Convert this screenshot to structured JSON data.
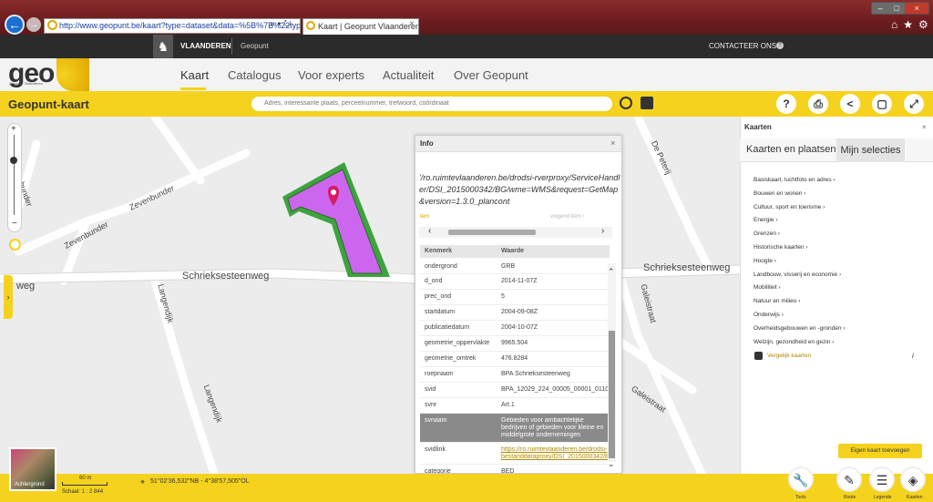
{
  "browser": {
    "url": "http://www.geopunt.be/kaart?type=dataset&data=%5B%7B%22type",
    "tab_title": "Kaart | Geopunt Vlaanderen",
    "win_controls": [
      "–",
      "□",
      "×"
    ]
  },
  "topbar": {
    "org": "VLAANDEREN",
    "site": "Geopunt",
    "contact": "CONTACTEER ONS",
    "help": "?"
  },
  "logo": {
    "word": "geo",
    "sub": "Geopunt Vlaanderen"
  },
  "nav": {
    "items": [
      "Kaart",
      "Catalogus",
      "Voor experts",
      "Actualiteit",
      "Over Geopunt"
    ]
  },
  "toolbar": {
    "title": "Geopunt-kaart",
    "search_placeholder": "Adres, interessante plaats, perceelnummer, trefwoord, coördinaat",
    "buttons": [
      {
        "icon": "help-icon",
        "glyph": "?"
      },
      {
        "icon": "print-icon",
        "glyph": "⎙"
      },
      {
        "icon": "share-icon",
        "glyph": "<"
      },
      {
        "icon": "bookmark-icon",
        "glyph": "▢"
      },
      {
        "icon": "fullscreen-icon",
        "glyph": "⤢"
      }
    ]
  },
  "map": {
    "roads": [
      "Schrieksesteenweg",
      "Schrieksesteenweg",
      "weg",
      "Zevenbunder",
      "Zevenbunder",
      "bunder",
      "Langendijk",
      "Langendijk",
      "Galeistraat",
      "Galeistraat",
      "De Peterij"
    ],
    "parcel_color": "#cc66ee",
    "parcel_border": "#3ea33e",
    "marker_color": "#d81b60"
  },
  "zoom": {
    "plus": "+",
    "minus": "−"
  },
  "info": {
    "title": "Info",
    "close": "×",
    "url": "'/ro.ruimtevlaanderen.be/drodsi-rverproxy/ServiceHandler/DSI_2015000342/BG/wme=WMS&request=GetMap&version=1.3.0_plancont",
    "prev": "tern",
    "next": "volgend item ›",
    "headers": [
      "Kenmerk",
      "Waarde"
    ],
    "rows": [
      {
        "k": "ondergrond",
        "v": "GRB"
      },
      {
        "k": "d_ond",
        "v": "2014-11-07Z"
      },
      {
        "k": "prec_ond",
        "v": "5"
      },
      {
        "k": "startdatum",
        "v": "2004-09-08Z"
      },
      {
        "k": "publicatiedatum",
        "v": "2004-10-07Z"
      },
      {
        "k": "geometrie_oppervlakte",
        "v": "9965.504"
      },
      {
        "k": "geometrie_omtrek",
        "v": "476.8284"
      },
      {
        "k": "roepnaam",
        "v": "BPA Schrieksesteenweg"
      },
      {
        "k": "svid",
        "v": "BPA_12029_224_00005_00001_01100"
      },
      {
        "k": "svnr",
        "v": "Art.1"
      },
      {
        "k": "svnaam",
        "v": "Gebieden voor ambachtelijke bedrijven of gebieden voor kleine en middelgrote ondernemingen"
      },
      {
        "k": "svidlink",
        "v": "https://ro.ruimtevlaanderen.be/drodsi-bestanddataproxy/DSI_2015000342/BG"
      },
      {
        "k": "categorie",
        "v": "BED"
      }
    ]
  },
  "kaarten": {
    "title": "Kaarten",
    "close": "×",
    "tabs": [
      "Kaarten en plaatsen",
      "Mijn selecties"
    ],
    "categories": [
      "Basiskaart, luchtfoto en adres ›",
      "Bouwen en wonen ›",
      "Cultuur, sport en toerisme ›",
      "Energie ›",
      "Grenzen ›",
      "Historische kaarten ›",
      "Hoogte ›",
      "Landbouw, visserij en economie ›",
      "Mobiliteit ›",
      "Natuur en milieu ›",
      "Onderwijs ›",
      "Overheidsgebouwen en -gronden ›",
      "Welzijn, gezondheid en gezin ›"
    ],
    "compare": "Vergelijk kaarten",
    "info_icon": "i",
    "add_map": "Eigen kaart toevoegen"
  },
  "bottom": {
    "background_label": "Achtergrond",
    "scale_label": "60 m",
    "scale_ratio": "Schaal: 1 : 2 844",
    "coords": "51°02'36,532\"NB - 4°38'57,505\"OL",
    "tools": [
      {
        "label": "Tools",
        "glyph": "🔧"
      },
      {
        "label": "Route",
        "glyph": "✎"
      },
      {
        "label": "Legende",
        "glyph": "☰"
      },
      {
        "label": "Kaarten",
        "glyph": "◈"
      }
    ]
  }
}
